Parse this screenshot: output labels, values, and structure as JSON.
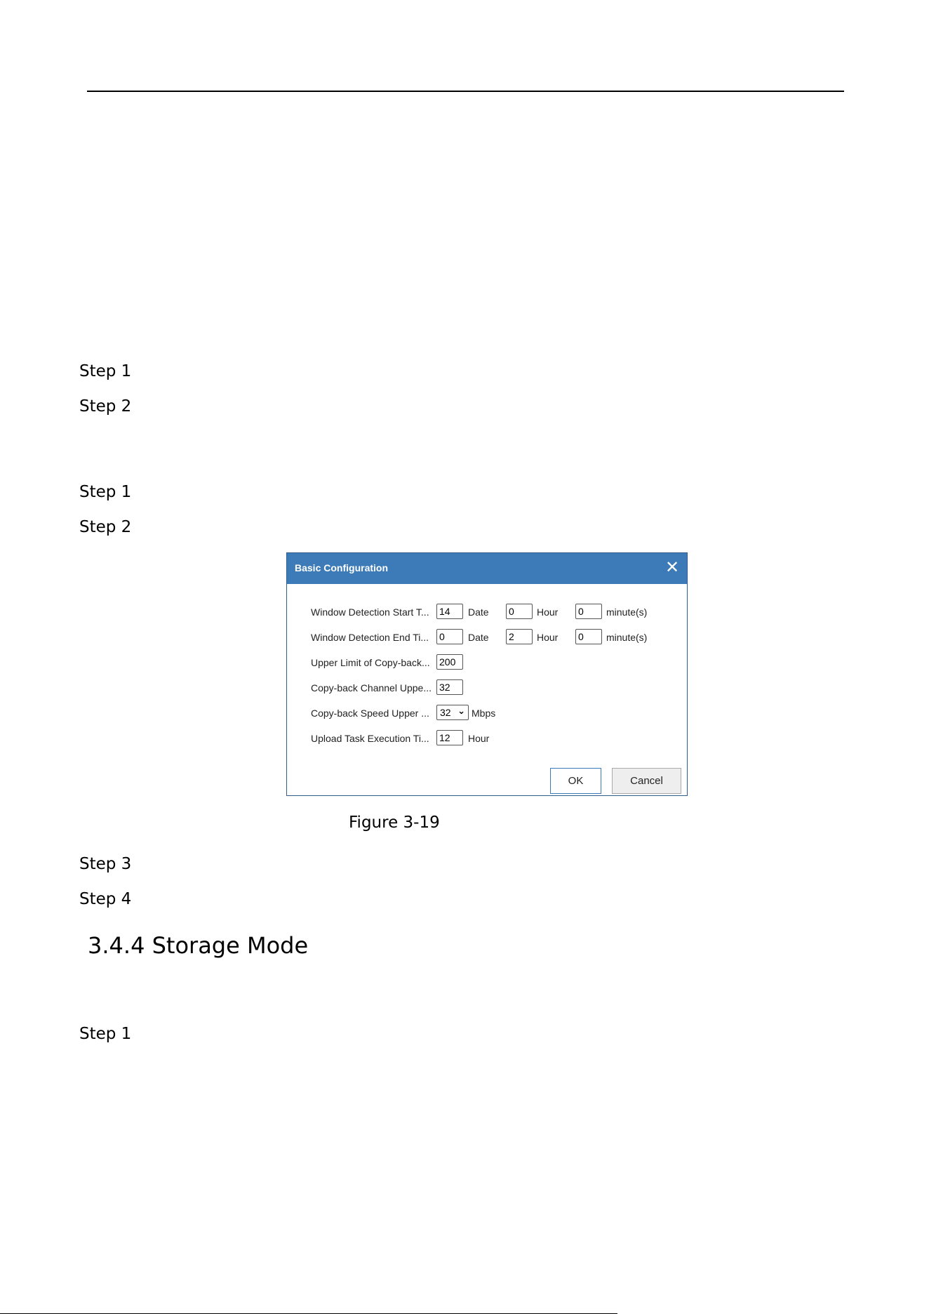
{
  "steps": [
    "Step 1",
    "Step 2",
    "Step 1",
    "Step 2",
    "Step 3",
    "Step 4",
    "Step 1"
  ],
  "figure_caption": "Figure 3-19",
  "section_title": "3.4.4 Storage Mode",
  "dialog": {
    "title": "Basic Configuration",
    "close_icon": "close-icon",
    "rows": [
      {
        "label": "Window Detection Start T...",
        "date": "14",
        "date_unit": "Date",
        "hour": "0",
        "hour_unit": "Hour",
        "minute": "0",
        "minute_unit": "minute(s)"
      },
      {
        "label": "Window Detection End Ti...",
        "date": "0",
        "date_unit": "Date",
        "hour": "2",
        "hour_unit": "Hour",
        "minute": "0",
        "minute_unit": "minute(s)"
      },
      {
        "label": "Upper Limit of Copy-back...",
        "value": "200"
      },
      {
        "label": "Copy-back Channel Uppe...",
        "value": "32"
      },
      {
        "label": "Copy-back Speed Upper ...",
        "selected": "32",
        "unit": "Mbps"
      },
      {
        "label": "Upload Task Execution Ti...",
        "value": "12",
        "unit": "Hour"
      }
    ],
    "ok_label": "OK",
    "cancel_label": "Cancel"
  }
}
